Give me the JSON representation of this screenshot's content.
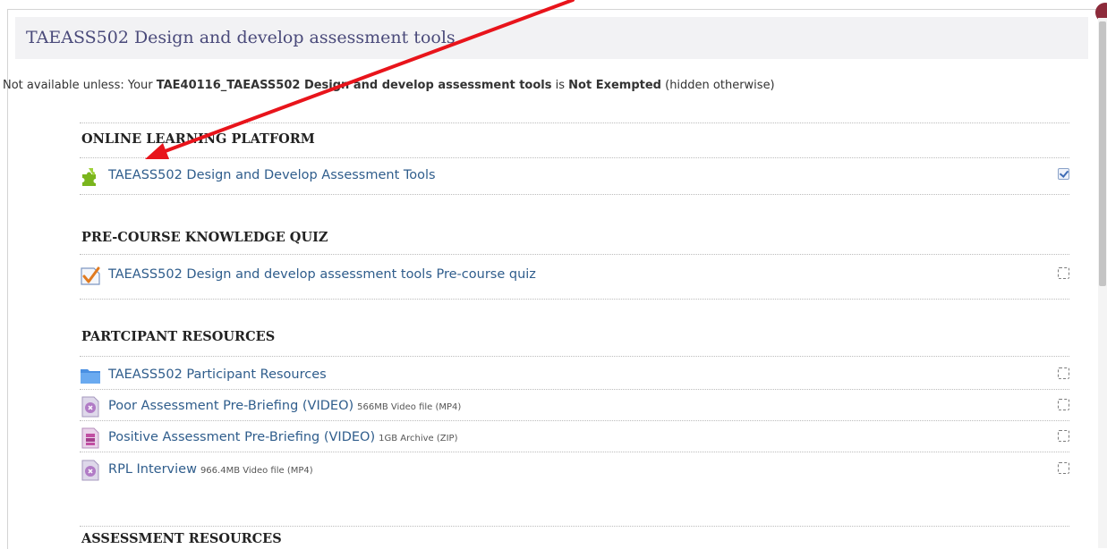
{
  "section": {
    "title": "TAEASS502 Design and develop assessment tools",
    "availability": {
      "prefix": "Not available unless: Your ",
      "requirement": "TAE40116_TAEASS502 Design and develop assessment tools",
      "middle": " is ",
      "status": "Not Exempted",
      "suffix": " (hidden otherwise)"
    }
  },
  "groups": {
    "online": {
      "title": "ONLINE LEARNING PLATFORM"
    },
    "quiz": {
      "title": "PRE-COURSE KNOWLEDGE QUIZ"
    },
    "resources": {
      "title": "PARTCIPANT RESOURCES"
    },
    "assessment": {
      "title": "ASSESSMENT RESOURCES"
    }
  },
  "activities": {
    "scorm": {
      "label": "TAEASS502 Design and Develop Assessment Tools",
      "icon": "puzzle-icon",
      "completed": true
    },
    "precourse_quiz": {
      "label": "TAEASS502 Design and develop assessment tools Pre-course quiz",
      "icon": "quiz-icon",
      "completed": false
    },
    "participant_resources": {
      "label": "TAEASS502 Participant Resources",
      "icon": "folder-icon",
      "completed": false
    },
    "poor_prebriefing": {
      "label": "Poor Assessment Pre-Briefing (VIDEO)",
      "meta": "566MB Video file (MP4)",
      "icon": "video-file-icon",
      "completed": false
    },
    "positive_prebriefing": {
      "label": "Positive Assessment Pre-Briefing (VIDEO)",
      "meta": "1GB Archive (ZIP)",
      "icon": "archive-file-icon",
      "completed": false
    },
    "rpl_interview": {
      "label": "RPL Interview",
      "meta": "966.4MB Video file (MP4)",
      "icon": "video-file-icon",
      "completed": false
    }
  },
  "colors": {
    "link": "#2f5d8c",
    "arrow": "#e8141b",
    "header_bg": "#f2f2f4"
  }
}
